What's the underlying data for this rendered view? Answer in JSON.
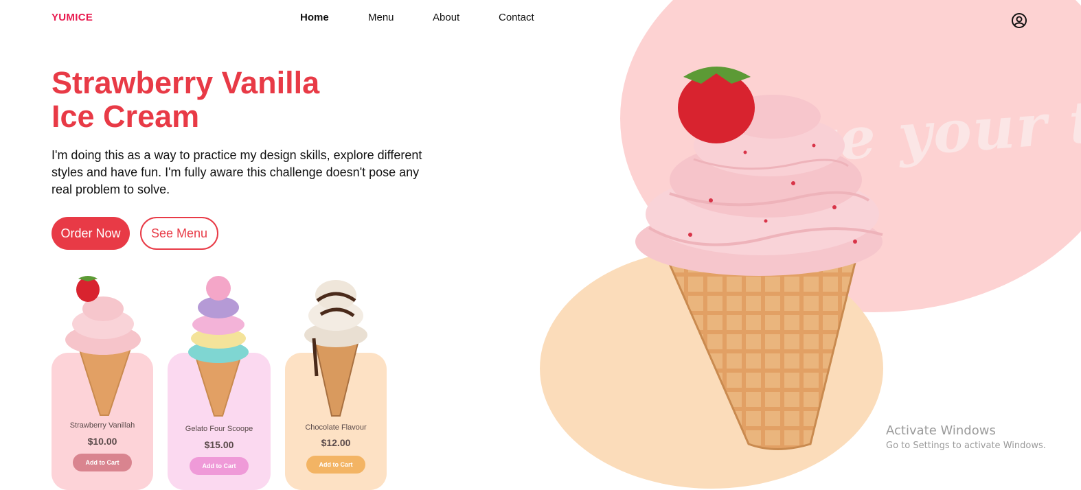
{
  "brand": {
    "logo": "YUMICE",
    "accent": "#e83a46",
    "logo_color": "#e8194e"
  },
  "nav": {
    "items": [
      {
        "label": "Home",
        "active": true
      },
      {
        "label": "Menu",
        "active": false
      },
      {
        "label": "About",
        "active": false
      },
      {
        "label": "Contact",
        "active": false
      }
    ],
    "user_icon": "user-circle-icon"
  },
  "hero": {
    "title_line1": "Strawberry Vanilla",
    "title_line2": "Ice Cream",
    "description": "I'm doing this as a way to practice my design skills, explore different styles and have fun. I'm fully aware this challenge doesn't pose any real problem to solve.",
    "order_button": "Order Now",
    "menu_button": "See Menu",
    "background_script": "ve your taste"
  },
  "products": [
    {
      "name": "Strawberry Vanillah",
      "price": "$10.00",
      "button": "Add to Cart",
      "card_color": "#fdd3d8",
      "button_color": "#d9848f"
    },
    {
      "name": "Gelato Four Scoope",
      "price": "$15.00",
      "button": "Add to Cart",
      "card_color": "#fbd9f0",
      "button_color": "#ef9ad8"
    },
    {
      "name": "Chocolate Flavour",
      "price": "$12.00",
      "button": "Add to Cart",
      "card_color": "#fde1c4",
      "button_color": "#f3b464"
    }
  ],
  "system_overlay": {
    "line1": "Activate Windows",
    "line2": "Go to Settings to activate Windows."
  }
}
